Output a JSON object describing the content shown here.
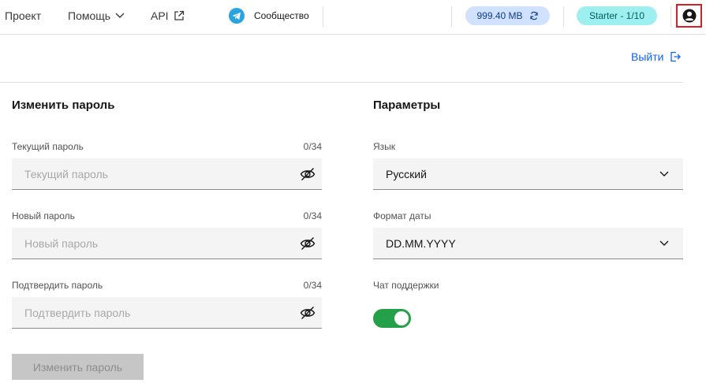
{
  "nav": {
    "project": "Проект",
    "help": "Помощь",
    "api": "API",
    "community": "Сообщество",
    "storage": "999.40 MB",
    "plan": "Starter - 1/10"
  },
  "logout": "Выйти",
  "password": {
    "title": "Изменить пароль",
    "current": {
      "label": "Текущий пароль",
      "counter": "0/34",
      "placeholder": "Текущий пароль"
    },
    "new": {
      "label": "Новый пароль",
      "counter": "0/34",
      "placeholder": "Новый пароль"
    },
    "confirm": {
      "label": "Подтвердить пароль",
      "counter": "0/34",
      "placeholder": "Подтвердить пароль"
    },
    "submit": "Изменить пароль"
  },
  "params": {
    "title": "Параметры",
    "language": {
      "label": "Язык",
      "value": "Русский"
    },
    "date_format": {
      "label": "Формат даты",
      "value": "DD.MM.YYYY"
    },
    "support_chat": {
      "label": "Чат поддержки",
      "enabled": true
    }
  },
  "colors": {
    "accent": "#0f62fe",
    "toggle_on": "#24a148",
    "storage_pill": "#d0e2ff",
    "plan_pill": "#9ef0f0",
    "highlight_border": "#da1e28"
  },
  "icons": [
    "chevron-down-icon",
    "external-link-icon",
    "telegram-icon",
    "refresh-icon",
    "user-avatar-icon",
    "logout-icon",
    "eye-off-icon"
  ]
}
